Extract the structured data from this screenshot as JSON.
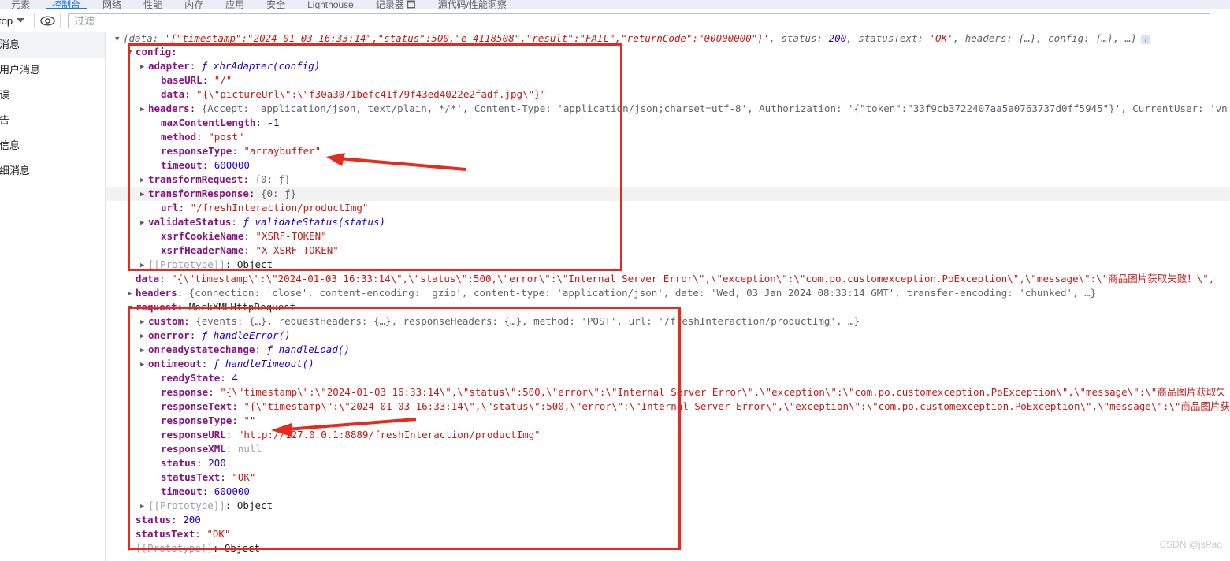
{
  "devtools": {
    "tabs": [
      {
        "label": "元素",
        "active": false
      },
      {
        "label": "控制台",
        "active": true
      },
      {
        "label": "网络",
        "active": false
      },
      {
        "label": "性能",
        "active": false
      },
      {
        "label": "内存",
        "active": false
      },
      {
        "label": "应用",
        "active": false
      },
      {
        "label": "安全",
        "active": false
      },
      {
        "label": "Lighthouse",
        "active": false
      },
      {
        "label": "记录器 🗖",
        "active": false
      },
      {
        "label": "源代码/性能洞察",
        "active": false
      }
    ]
  },
  "toolbar": {
    "context_label": "top",
    "caret_icon": "chevron-down-icon",
    "eye_icon": "eye-icon",
    "filter_placeholder": "过滤",
    "filter_value": ""
  },
  "sidebar": {
    "items": [
      {
        "label": "条消息",
        "selected": true
      },
      {
        "label": "条用户消息",
        "selected": false
      },
      {
        "label": "错误",
        "selected": false
      },
      {
        "label": "警告",
        "selected": false
      },
      {
        "label": "条信息",
        "selected": false
      },
      {
        "label": "详细消息",
        "selected": false
      }
    ]
  },
  "console": {
    "header": {
      "prefix": "{data: ",
      "data_value": "'{\"timestamp\":\"2024-01-03 16:33:14\",\"status\":500,\"e_4118508\",\"result\":\"FAIL\",\"returnCode\":\"00000000\"}'",
      "status_key": ", status: ",
      "status_value": "200",
      "statusText_key": ", statusText: ",
      "statusText_value": "'OK'",
      "headers_key": ", headers: ",
      "headers_value": "{…}",
      "config_key": ", config: ",
      "config_value": "{…}",
      "ellipsis": ", …}",
      "info_icon": "info-icon"
    },
    "config": {
      "label": "config:",
      "rows": [
        {
          "indent": 2,
          "tri": "closed",
          "key": "adapter",
          "sep": ": ",
          "fn": "ƒ xhrAdapter(config)"
        },
        {
          "indent": 3,
          "tri": "none",
          "key": "baseURL",
          "sep": ": ",
          "str": "\"/\""
        },
        {
          "indent": 3,
          "tri": "none",
          "key": "data",
          "sep": ": ",
          "str": "\"{\\\"pictureUrl\\\":\\\"f30a3071befc41f79f43ed4022e2fadf.jpg\\\"}\""
        },
        {
          "indent": 2,
          "tri": "closed",
          "key": "headers",
          "sep": ": ",
          "preview": "{Accept: 'application/json, text/plain, */*', Content-Type: 'application/json;charset=utf-8', Authorization: '{\"token\":\"33f9cb3722407aa5a0763737d0ff5945\"}', CurrentUser: 'vn"
        },
        {
          "indent": 3,
          "tri": "none",
          "key": "maxContentLength",
          "sep": ": ",
          "num": "-1"
        },
        {
          "indent": 3,
          "tri": "none",
          "key": "method",
          "sep": ": ",
          "str": "\"post\""
        },
        {
          "indent": 3,
          "tri": "none",
          "key": "responseType",
          "sep": ": ",
          "str": "\"arraybuffer\""
        },
        {
          "indent": 3,
          "tri": "none",
          "key": "timeout",
          "sep": ": ",
          "num": "600000"
        },
        {
          "indent": 2,
          "tri": "closed",
          "key": "transformRequest",
          "sep": ": ",
          "obj": "{0: ƒ}"
        },
        {
          "indent": 2,
          "tri": "closed",
          "key": "transformResponse",
          "sep": ": ",
          "obj": "{0: ƒ}",
          "shaded": true
        },
        {
          "indent": 3,
          "tri": "none",
          "key": "url",
          "sep": ": ",
          "str": "\"/freshInteraction/productImg\""
        },
        {
          "indent": 2,
          "tri": "closed",
          "key": "validateStatus",
          "sep": ": ",
          "fn": "ƒ validateStatus(status)"
        },
        {
          "indent": 3,
          "tri": "none",
          "key": "xsrfCookieName",
          "sep": ": ",
          "str": "\"XSRF-TOKEN\""
        },
        {
          "indent": 3,
          "tri": "none",
          "key": "xsrfHeaderName",
          "sep": ": ",
          "str": "\"X-XSRF-TOKEN\""
        },
        {
          "indent": 2,
          "tri": "closed",
          "key": "[[Prototype]]",
          "sep": ": ",
          "plain": "Object",
          "grey_key": true
        }
      ]
    },
    "top_level": [
      {
        "indent": 1,
        "tri": "none",
        "key": "data",
        "sep": ": ",
        "str": "\"{\\\"timestamp\\\":\\\"2024-01-03 16:33:14\\\",\\\"status\\\":500,\\\"error\\\":\\\"Internal Server Error\\\",\\\"exception\\\":\\\"com.po.customexception.PoException\\\",\\\"message\\\":\\\"商品图片获取失败！\\\","
      },
      {
        "indent": 1,
        "tri": "closed",
        "key": "headers",
        "sep": ": ",
        "preview": "{connection: 'close', content-encoding: 'gzip', content-type: 'application/json', date: 'Wed, 03 Jan 2024 08:33:14 GMT', transfer-encoding: 'chunked', …}"
      }
    ],
    "request": {
      "label": "request:",
      "type": "MockXMLHttpRequest",
      "rows": [
        {
          "indent": 2,
          "tri": "closed",
          "key": "custom",
          "sep": ": ",
          "preview": "{events: {…}, requestHeaders: {…}, responseHeaders: {…}, method: 'POST', url: '/freshInteraction/productImg', …}"
        },
        {
          "indent": 2,
          "tri": "closed",
          "key": "onerror",
          "sep": ": ",
          "fn": "ƒ handleError()"
        },
        {
          "indent": 2,
          "tri": "closed",
          "key": "onreadystatechange",
          "sep": ": ",
          "fn": "ƒ handleLoad()"
        },
        {
          "indent": 2,
          "tri": "closed",
          "key": "ontimeout",
          "sep": ": ",
          "fn": "ƒ handleTimeout()"
        },
        {
          "indent": 3,
          "tri": "none",
          "key": "readyState",
          "sep": ": ",
          "num": "4"
        },
        {
          "indent": 3,
          "tri": "none",
          "key": "response",
          "sep": ": ",
          "str": "\"{\\\"timestamp\\\":\\\"2024-01-03 16:33:14\\\",\\\"status\\\":500,\\\"error\\\":\\\"Internal Server Error\\\",\\\"exception\\\":\\\"com.po.customexception.PoException\\\",\\\"message\\\":\\\"商品图片获取失"
        },
        {
          "indent": 3,
          "tri": "none",
          "key": "responseText",
          "sep": ": ",
          "str": "\"{\\\"timestamp\\\":\\\"2024-01-03 16:33:14\\\",\\\"status\\\":500,\\\"error\\\":\\\"Internal Server Error\\\",\\\"exception\\\":\\\"com.po.customexception.PoException\\\",\\\"message\\\":\\\"商品图片获取"
        },
        {
          "indent": 3,
          "tri": "none",
          "key": "responseType",
          "sep": ": ",
          "str": "\"\""
        },
        {
          "indent": 3,
          "tri": "none",
          "key": "responseURL",
          "sep": ": ",
          "str": "\"http://127.0.0.1:8889/freshInteraction/productImg\""
        },
        {
          "indent": 3,
          "tri": "none",
          "key": "responseXML",
          "sep": ": ",
          "nul": "null"
        },
        {
          "indent": 3,
          "tri": "none",
          "key": "status",
          "sep": ": ",
          "num": "200"
        },
        {
          "indent": 3,
          "tri": "none",
          "key": "statusText",
          "sep": ": ",
          "str": "\"OK\""
        },
        {
          "indent": 3,
          "tri": "none",
          "key": "timeout",
          "sep": ": ",
          "num": "600000"
        },
        {
          "indent": 2,
          "tri": "closed",
          "key": "[[Prototype]]",
          "sep": ": ",
          "plain": "Object",
          "grey_key": true
        }
      ]
    },
    "tail": [
      {
        "indent": 1,
        "tri": "none",
        "key": "status",
        "sep": ": ",
        "num": "200"
      },
      {
        "indent": 1,
        "tri": "none",
        "key": "statusText",
        "sep": ": ",
        "str": "\"OK\""
      },
      {
        "indent": 1,
        "tri": "closed",
        "key": "[[Prototype]]",
        "sep": ": ",
        "plain": "Object",
        "grey_key": true
      }
    ]
  },
  "annotations": {
    "box_color": "#e8291c",
    "arrow_color": "#e8291c",
    "arrow_1_target": "responseType: \"arraybuffer\"",
    "arrow_2_target": "responseType: \"\""
  },
  "watermark": {
    "text": "CSDN @jsPao"
  }
}
